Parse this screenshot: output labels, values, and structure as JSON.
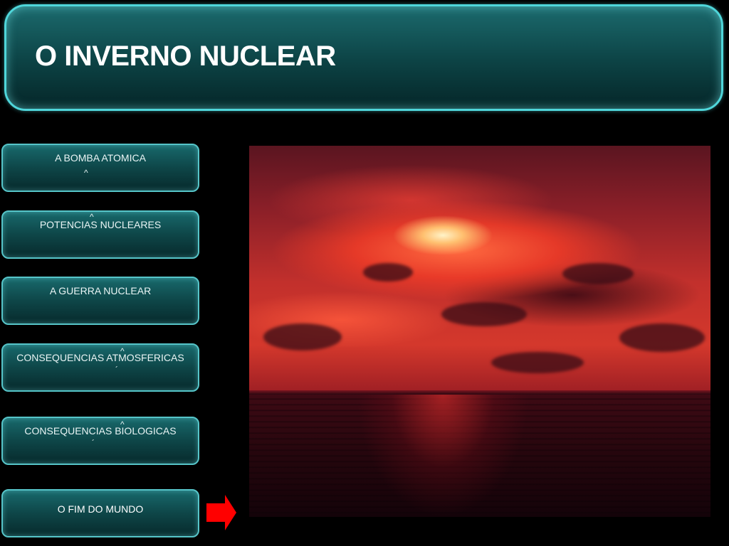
{
  "slide": {
    "title": "O INVERNO NUCLEAR"
  },
  "nav": {
    "items": [
      {
        "label": "A BOMBA ATOMICA"
      },
      {
        "label": "POTENCIAS NUCLEARES"
      },
      {
        "label": "A GUERRA NUCLEAR"
      },
      {
        "label": "CONSEQUENCIAS ATMOSFERICAS"
      },
      {
        "label": "CONSEQUENCIAS BIOLOGICAS"
      },
      {
        "label": "O FIM DO MUNDO"
      }
    ]
  },
  "marks": {
    "circumflex": "^",
    "acute": "´"
  },
  "colors": {
    "accent_border": "#4fd6da",
    "panel_dark": "#0c4244",
    "arrow_red": "#ff0000"
  },
  "icons": {
    "next": "right-arrow-icon"
  }
}
